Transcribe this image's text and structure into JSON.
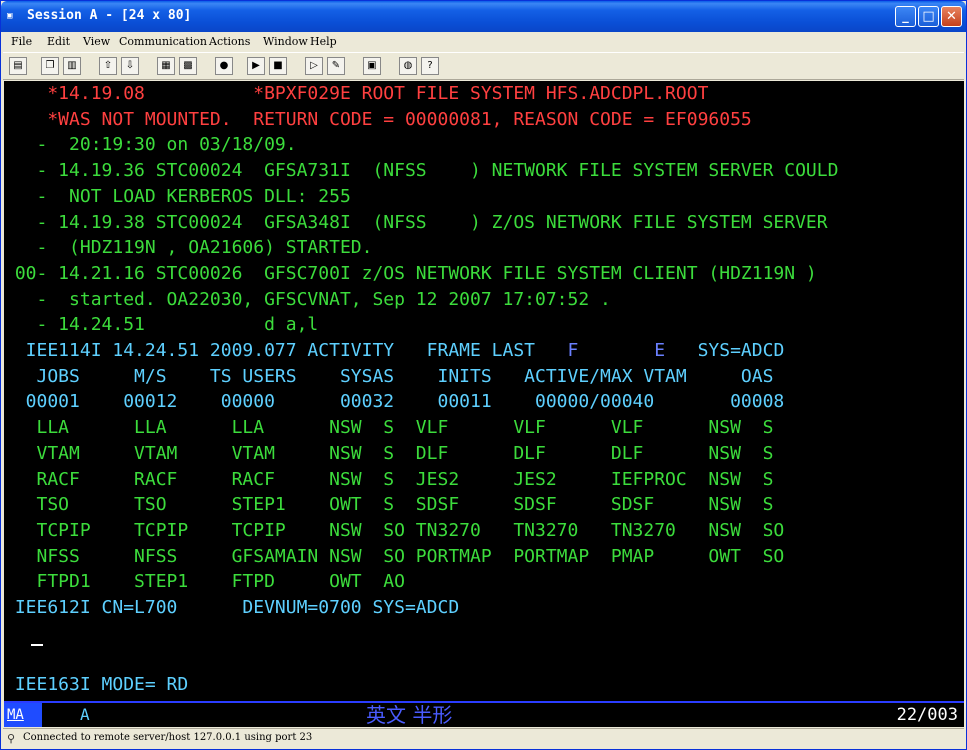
{
  "window": {
    "icon": "terminal-icon",
    "title": "Session A - [24 x 80]",
    "controls": {
      "minimize": "_",
      "maximize": "□",
      "close": "✕"
    }
  },
  "menu": [
    "File",
    "Edit",
    "View",
    "Communication",
    "Actions",
    "Window",
    "Help"
  ],
  "toolbar_icons": [
    "print-screen-icon",
    "copy-icon",
    "paste-icon",
    "send-icon",
    "receive-icon",
    "display-icon",
    "keypad-icon",
    "record-macro-icon",
    "play-macro-icon",
    "stop-macro-icon",
    "clipboard-icon",
    "globe-icon",
    "help-icon"
  ],
  "colors": {
    "red": "#ff4040",
    "green": "#3cdc3c",
    "cyan": "#5ed0ff",
    "blue": "#6a80ff",
    "oia_bg": "#1f4cff"
  },
  "terminal": {
    "lines": [
      {
        "text": "    *14.19.08          *BPXF029E ROOT FILE SYSTEM HFS.ADCDPL.ROOT",
        "color": "red"
      },
      {
        "text": "    *WAS NOT MOUNTED.  RETURN CODE = 00000081, REASON CODE = EF096055",
        "color": "red"
      },
      {
        "text": "   -  20:19:30 on 03/18/09.",
        "color": "green"
      },
      {
        "text": "   - 14.19.36 STC00024  GFSA731I  (NFSS    ) NETWORK FILE SYSTEM SERVER COULD",
        "color": "green"
      },
      {
        "text": "   -  NOT LOAD KERBEROS DLL: 255",
        "color": "green"
      },
      {
        "text": "   - 14.19.38 STC00024  GFSA348I  (NFSS    ) Z/OS NETWORK FILE SYSTEM SERVER",
        "color": "green"
      },
      {
        "text": "   -  (HDZ119N , OA21606) STARTED.",
        "color": "green"
      },
      {
        "text": " 00- 14.21.16 STC00026  GFSC700I z/OS NETWORK FILE SYSTEM CLIENT (HDZ119N )",
        "color": "green"
      },
      {
        "text": "   -  started. OA22030, GFSCVNAT, Sep 12 2007 17:07:52 .",
        "color": "green"
      },
      {
        "text": "   - 14.24.51           d a,l",
        "color": "green"
      },
      {
        "segments": [
          {
            "text": "  IEE114I 14.24.51 2009.077 ACTIVITY   FRAME LAST  ",
            "color": "cyan"
          },
          {
            "text": " F      ",
            "color": "blue"
          },
          {
            "text": " E  ",
            "color": "blue"
          },
          {
            "text": " SYS=ADCD",
            "color": "cyan"
          }
        ]
      },
      {
        "text": "   JOBS     M/S    TS USERS    SYSAS    INITS   ACTIVE/MAX VTAM     OAS",
        "color": "cyan"
      },
      {
        "text": "  00001    00012    00000      00032    00011    00000/00040       00008",
        "color": "cyan"
      },
      {
        "text": "   LLA      LLA      LLA      NSW  S  VLF      VLF      VLF      NSW  S",
        "color": "green"
      },
      {
        "text": "   VTAM     VTAM     VTAM     NSW  S  DLF      DLF      DLF      NSW  S",
        "color": "green"
      },
      {
        "text": "   RACF     RACF     RACF     NSW  S  JES2     JES2     IEFPROC  NSW  S",
        "color": "green"
      },
      {
        "text": "   TSO      TSO      STEP1    OWT  S  SDSF     SDSF     SDSF     NSW  S",
        "color": "green"
      },
      {
        "text": "   TCPIP    TCPIP    TCPIP    NSW  SO TN3270   TN3270   TN3270   NSW  SO",
        "color": "green"
      },
      {
        "text": "   NFSS     NFSS     GFSAMAIN NSW  SO PORTMAP  PORTMAP  PMAP     OWT  SO",
        "color": "green"
      },
      {
        "text": "   FTPD1    STEP1    FTPD     OWT  AO",
        "color": "green"
      },
      {
        "text": " IEE612I CN=L700      DEVNUM=0700 SYS=ADCD",
        "color": "cyan"
      },
      {
        "text": "",
        "color": "green"
      },
      {
        "text": "",
        "color": "green"
      },
      {
        "text": " IEE163I MODE= RD",
        "color": "cyan"
      }
    ]
  },
  "oia": {
    "mode": "MA",
    "indicator": "A",
    "ime": "英文 半形",
    "cursor_pos": "22/003"
  },
  "statusbar": {
    "icon": "connection-icon",
    "text": "Connected to remote server/host 127.0.0.1 using port 23"
  }
}
